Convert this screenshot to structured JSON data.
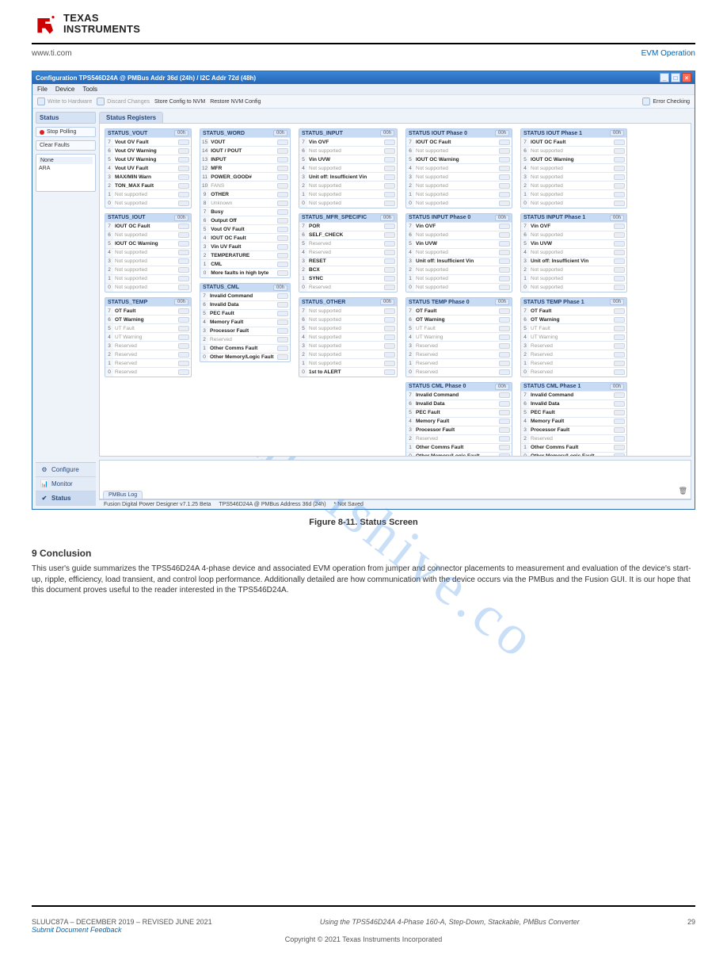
{
  "brand": {
    "l1": "TEXAS",
    "l2": "INSTRUMENTS"
  },
  "subheader": {
    "left_link": "www.ti.com",
    "right_doc": "EVM Operation"
  },
  "app": {
    "title": "Configuration TPS546D24A @ PMBus Addr 36d (24h) / I2C Addr 72d (48h)",
    "menu": [
      "File",
      "Device",
      "Tools"
    ],
    "toolbar": {
      "write": "Write to Hardware",
      "discard": "Discard Changes",
      "store": "Store Config to NVM",
      "restore": "Restore NVM Config",
      "error": "Error Checking"
    },
    "left": {
      "heading": "Status",
      "stop": "Stop Polling",
      "clear": "Clear Faults",
      "ara_hdr": "None",
      "ara_lab": "ARA"
    },
    "accordion": [
      {
        "icon": "⚙",
        "label": "Configure"
      },
      {
        "icon": "📊",
        "label": "Monitor"
      },
      {
        "icon": "✔",
        "label": "Status"
      }
    ],
    "tab": "Status Registers",
    "status_footer": {
      "app": "Fusion Digital Power Designer v7.1.25 Beta",
      "dev": "TPS546D24A @ PMBus Address 36d (24h)",
      "save": "* Not Saved"
    },
    "log_tab": "PMBus Log"
  },
  "registers": {
    "col1": [
      {
        "name": "STATUS_VOUT",
        "rows": [
          {
            "n": "7",
            "t": "Vout OV Fault",
            "b": 1
          },
          {
            "n": "6",
            "t": "Vout OV Warning",
            "b": 1
          },
          {
            "n": "5",
            "t": "Vout UV Warning",
            "b": 1
          },
          {
            "n": "4",
            "t": "Vout UV Fault",
            "b": 1
          },
          {
            "n": "3",
            "t": "MAX/MIN Warn",
            "b": 1
          },
          {
            "n": "2",
            "t": "TON_MAX Fault",
            "b": 1
          },
          {
            "n": "1",
            "t": "Not supported",
            "b": 0
          },
          {
            "n": "0",
            "t": "Not supported",
            "b": 0
          }
        ]
      },
      {
        "name": "STATUS_IOUT",
        "rows": [
          {
            "n": "7",
            "t": "IOUT OC Fault",
            "b": 1
          },
          {
            "n": "6",
            "t": "Not supported",
            "b": 0
          },
          {
            "n": "5",
            "t": "IOUT OC Warning",
            "b": 1
          },
          {
            "n": "4",
            "t": "Not supported",
            "b": 0
          },
          {
            "n": "3",
            "t": "Not supported",
            "b": 0
          },
          {
            "n": "2",
            "t": "Not supported",
            "b": 0
          },
          {
            "n": "1",
            "t": "Not supported",
            "b": 0
          },
          {
            "n": "0",
            "t": "Not supported",
            "b": 0
          }
        ]
      },
      {
        "name": "STATUS_TEMP",
        "rows": [
          {
            "n": "7",
            "t": "OT Fault",
            "b": 1
          },
          {
            "n": "6",
            "t": "OT Warning",
            "b": 1
          },
          {
            "n": "5",
            "t": "UT Fault",
            "b": 0
          },
          {
            "n": "4",
            "t": "UT Warning",
            "b": 0
          },
          {
            "n": "3",
            "t": "Reserved",
            "b": 0
          },
          {
            "n": "2",
            "t": "Reserved",
            "b": 0
          },
          {
            "n": "1",
            "t": "Reserved",
            "b": 0
          },
          {
            "n": "0",
            "t": "Reserved",
            "b": 0
          }
        ]
      }
    ],
    "col2": [
      {
        "name": "STATUS_WORD",
        "rows": [
          {
            "n": "15",
            "t": "VOUT",
            "b": 1
          },
          {
            "n": "14",
            "t": "IOUT / POUT",
            "b": 1
          },
          {
            "n": "13",
            "t": "INPUT",
            "b": 1
          },
          {
            "n": "12",
            "t": "MFR",
            "b": 1
          },
          {
            "n": "11",
            "t": "POWER_GOOD#",
            "b": 1
          },
          {
            "n": "10",
            "t": "FANS",
            "b": 0
          },
          {
            "n": "9",
            "t": "OTHER",
            "b": 1
          },
          {
            "n": "8",
            "t": "Unknown",
            "b": 0
          },
          {
            "n": "7",
            "t": "Busy",
            "b": 1
          },
          {
            "n": "6",
            "t": "Output Off",
            "b": 1
          },
          {
            "n": "5",
            "t": "Vout OV Fault",
            "b": 1
          },
          {
            "n": "4",
            "t": "IOUT OC Fault",
            "b": 1
          },
          {
            "n": "3",
            "t": "Vin UV Fault",
            "b": 1
          },
          {
            "n": "2",
            "t": "TEMPERATURE",
            "b": 1
          },
          {
            "n": "1",
            "t": "CML",
            "b": 1
          },
          {
            "n": "0",
            "t": "More faults in high byte",
            "b": 1
          }
        ]
      },
      {
        "name": "STATUS_CML",
        "rows": [
          {
            "n": "7",
            "t": "Invalid Command",
            "b": 1
          },
          {
            "n": "6",
            "t": "Invalid Data",
            "b": 1
          },
          {
            "n": "5",
            "t": "PEC Fault",
            "b": 1
          },
          {
            "n": "4",
            "t": "Memory Fault",
            "b": 1
          },
          {
            "n": "3",
            "t": "Processor Fault",
            "b": 1
          },
          {
            "n": "2",
            "t": "Reserved",
            "b": 0
          },
          {
            "n": "1",
            "t": "Other Comms Fault",
            "b": 1
          },
          {
            "n": "0",
            "t": "Other Memory/Logic Fault",
            "b": 1
          }
        ]
      }
    ],
    "col3": [
      {
        "name": "STATUS_INPUT",
        "rows": [
          {
            "n": "7",
            "t": "Vin OVF",
            "b": 1
          },
          {
            "n": "6",
            "t": "Not supported",
            "b": 0
          },
          {
            "n": "5",
            "t": "Vin UVW",
            "b": 1
          },
          {
            "n": "4",
            "t": "Not supported",
            "b": 0
          },
          {
            "n": "3",
            "t": "Unit off: Insufficient Vin",
            "b": 1
          },
          {
            "n": "2",
            "t": "Not supported",
            "b": 0
          },
          {
            "n": "1",
            "t": "Not supported",
            "b": 0
          },
          {
            "n": "0",
            "t": "Not supported",
            "b": 0
          }
        ]
      },
      {
        "name": "STATUS_MFR_SPECIFIC",
        "rows": [
          {
            "n": "7",
            "t": "POR",
            "b": 1
          },
          {
            "n": "6",
            "t": "SELF_CHECK",
            "b": 1
          },
          {
            "n": "5",
            "t": "Reserved",
            "b": 0
          },
          {
            "n": "4",
            "t": "Reserved",
            "b": 0
          },
          {
            "n": "3",
            "t": "RESET",
            "b": 1
          },
          {
            "n": "2",
            "t": "BCX",
            "b": 1
          },
          {
            "n": "1",
            "t": "SYNC",
            "b": 1
          },
          {
            "n": "0",
            "t": "Reserved",
            "b": 0
          }
        ]
      },
      {
        "name": "STATUS_OTHER",
        "rows": [
          {
            "n": "7",
            "t": "Not supported",
            "b": 0
          },
          {
            "n": "6",
            "t": "Not supported",
            "b": 0
          },
          {
            "n": "5",
            "t": "Not supported",
            "b": 0
          },
          {
            "n": "4",
            "t": "Not supported",
            "b": 0
          },
          {
            "n": "3",
            "t": "Not supported",
            "b": 0
          },
          {
            "n": "2",
            "t": "Not supported",
            "b": 0
          },
          {
            "n": "1",
            "t": "Not supported",
            "b": 0
          },
          {
            "n": "0",
            "t": "1st to ALERT",
            "b": 1
          }
        ]
      }
    ],
    "col4": [
      {
        "name": "STATUS IOUT Phase 0",
        "rows": [
          {
            "n": "7",
            "t": "IOUT OC Fault",
            "b": 1
          },
          {
            "n": "6",
            "t": "Not supported",
            "b": 0
          },
          {
            "n": "5",
            "t": "IOUT OC Warning",
            "b": 1
          },
          {
            "n": "4",
            "t": "Not supported",
            "b": 0
          },
          {
            "n": "3",
            "t": "Not supported",
            "b": 0
          },
          {
            "n": "2",
            "t": "Not supported",
            "b": 0
          },
          {
            "n": "1",
            "t": "Not supported",
            "b": 0
          },
          {
            "n": "0",
            "t": "Not supported",
            "b": 0
          }
        ]
      },
      {
        "name": "STATUS INPUT Phase 0",
        "rows": [
          {
            "n": "7",
            "t": "Vin OVF",
            "b": 1
          },
          {
            "n": "6",
            "t": "Not supported",
            "b": 0
          },
          {
            "n": "5",
            "t": "Vin UVW",
            "b": 1
          },
          {
            "n": "4",
            "t": "Not supported",
            "b": 0
          },
          {
            "n": "3",
            "t": "Unit off: Insufficient Vin",
            "b": 1
          },
          {
            "n": "2",
            "t": "Not supported",
            "b": 0
          },
          {
            "n": "1",
            "t": "Not supported",
            "b": 0
          },
          {
            "n": "0",
            "t": "Not supported",
            "b": 0
          }
        ]
      },
      {
        "name": "STATUS TEMP Phase 0",
        "rows": [
          {
            "n": "7",
            "t": "OT Fault",
            "b": 1
          },
          {
            "n": "6",
            "t": "OT Warning",
            "b": 1
          },
          {
            "n": "5",
            "t": "UT Fault",
            "b": 0
          },
          {
            "n": "4",
            "t": "UT Warning",
            "b": 0
          },
          {
            "n": "3",
            "t": "Reserved",
            "b": 0
          },
          {
            "n": "2",
            "t": "Reserved",
            "b": 0
          },
          {
            "n": "1",
            "t": "Reserved",
            "b": 0
          },
          {
            "n": "0",
            "t": "Reserved",
            "b": 0
          }
        ]
      },
      {
        "name": "STATUS CML Phase 0",
        "rows": [
          {
            "n": "7",
            "t": "Invalid Command",
            "b": 1
          },
          {
            "n": "6",
            "t": "Invalid Data",
            "b": 1
          },
          {
            "n": "5",
            "t": "PEC Fault",
            "b": 1
          },
          {
            "n": "4",
            "t": "Memory Fault",
            "b": 1
          },
          {
            "n": "3",
            "t": "Processor Fault",
            "b": 1
          },
          {
            "n": "2",
            "t": "Reserved",
            "b": 0
          },
          {
            "n": "1",
            "t": "Other Comms Fault",
            "b": 1
          },
          {
            "n": "0",
            "t": "Other Memory/Logic Fault",
            "b": 1
          }
        ]
      }
    ],
    "col5": [
      {
        "name": "STATUS IOUT Phase 1",
        "rows": [
          {
            "n": "7",
            "t": "IOUT OC Fault",
            "b": 1
          },
          {
            "n": "6",
            "t": "Not supported",
            "b": 0
          },
          {
            "n": "5",
            "t": "IOUT OC Warning",
            "b": 1
          },
          {
            "n": "4",
            "t": "Not supported",
            "b": 0
          },
          {
            "n": "3",
            "t": "Not supported",
            "b": 0
          },
          {
            "n": "2",
            "t": "Not supported",
            "b": 0
          },
          {
            "n": "1",
            "t": "Not supported",
            "b": 0
          },
          {
            "n": "0",
            "t": "Not supported",
            "b": 0
          }
        ]
      },
      {
        "name": "STATUS INPUT Phase 1",
        "rows": [
          {
            "n": "7",
            "t": "Vin OVF",
            "b": 1
          },
          {
            "n": "6",
            "t": "Not supported",
            "b": 0
          },
          {
            "n": "5",
            "t": "Vin UVW",
            "b": 1
          },
          {
            "n": "4",
            "t": "Not supported",
            "b": 0
          },
          {
            "n": "3",
            "t": "Unit off: Insufficient Vin",
            "b": 1
          },
          {
            "n": "2",
            "t": "Not supported",
            "b": 0
          },
          {
            "n": "1",
            "t": "Not supported",
            "b": 0
          },
          {
            "n": "0",
            "t": "Not supported",
            "b": 0
          }
        ]
      },
      {
        "name": "STATUS TEMP Phase 1",
        "rows": [
          {
            "n": "7",
            "t": "OT Fault",
            "b": 1
          },
          {
            "n": "6",
            "t": "OT Warning",
            "b": 1
          },
          {
            "n": "5",
            "t": "UT Fault",
            "b": 0
          },
          {
            "n": "4",
            "t": "UT Warning",
            "b": 0
          },
          {
            "n": "3",
            "t": "Reserved",
            "b": 0
          },
          {
            "n": "2",
            "t": "Reserved",
            "b": 0
          },
          {
            "n": "1",
            "t": "Reserved",
            "b": 0
          },
          {
            "n": "0",
            "t": "Reserved",
            "b": 0
          }
        ]
      },
      {
        "name": "STATUS CML Phase 1",
        "rows": [
          {
            "n": "7",
            "t": "Invalid Command",
            "b": 1
          },
          {
            "n": "6",
            "t": "Invalid Data",
            "b": 1
          },
          {
            "n": "5",
            "t": "PEC Fault",
            "b": 1
          },
          {
            "n": "4",
            "t": "Memory Fault",
            "b": 1
          },
          {
            "n": "3",
            "t": "Processor Fault",
            "b": 1
          },
          {
            "n": "2",
            "t": "Reserved",
            "b": 0
          },
          {
            "n": "1",
            "t": "Other Comms Fault",
            "b": 1
          },
          {
            "n": "0",
            "t": "Other Memory/Logic Fault",
            "b": 1
          }
        ]
      }
    ]
  },
  "figure_caption": "Figure 8-11. Status Screen",
  "conclusion": {
    "title": "9   Conclusion",
    "text": "This user's guide summarizes the TPS546D24A 4-phase device and associated EVM operation from jumper and connector placements to measurement and evaluation of the device's start-up, ripple, efficiency, load transient, and control loop performance. Additionally detailed are how communication with the device occurs via the PMBus and the Fusion GUI. It is our hope that this document proves useful to the reader interested in the TPS546D24A."
  },
  "footer": {
    "doc": "SLUUC87A – DECEMBER 2019 – REVISED JUNE 2021",
    "title": "Using the TPS546D24A 4-Phase 160-A, Step-Down, Stackable, PMBus Converter",
    "feedback": "Submit Document Feedback",
    "page": "29",
    "copyright": "Copyright © 2021 Texas Instruments Incorporated"
  },
  "watermark": "manualshive.co"
}
